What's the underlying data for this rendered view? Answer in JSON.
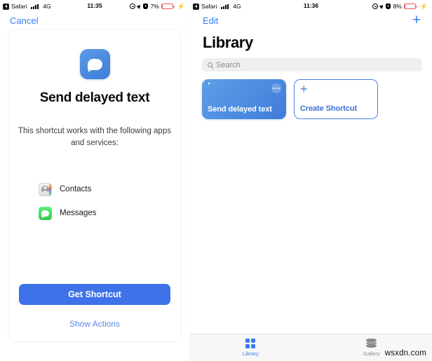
{
  "left_screen": {
    "status_bar": {
      "back_app": "Safari",
      "network": "4G",
      "time": "11:35",
      "battery_percent": "7%",
      "icons": [
        "back-arrow-icon",
        "signal-bars-icon",
        "do-not-disturb-icon",
        "location-arrow-icon",
        "alarm-icon",
        "battery-icon",
        "charging-bolt-icon"
      ]
    },
    "nav": {
      "cancel_label": "Cancel"
    },
    "shortcut": {
      "icon": "message-bubble-icon",
      "title": "Send delayed text",
      "description": "This shortcut works with the following apps and services:",
      "apps": [
        {
          "name": "Contacts",
          "icon": "contacts-app-icon"
        },
        {
          "name": "Messages",
          "icon": "messages-app-icon"
        }
      ]
    },
    "footer": {
      "get_shortcut_label": "Get Shortcut",
      "show_actions_label": "Show Actions"
    }
  },
  "right_screen": {
    "status_bar": {
      "back_app": "Safari",
      "network": "4G",
      "time": "11:36",
      "battery_percent": "8%",
      "icons": [
        "back-arrow-icon",
        "signal-bars-icon",
        "do-not-disturb-icon",
        "location-arrow-icon",
        "alarm-icon",
        "battery-icon",
        "charging-bolt-icon"
      ]
    },
    "nav": {
      "edit_label": "Edit",
      "add_label": "+"
    },
    "page_title": "Library",
    "search": {
      "placeholder": "Search",
      "value": "",
      "icon": "search-icon"
    },
    "cards": [
      {
        "label": "Send delayed text",
        "icon": "message-bubble-icon",
        "menu_icon": "ellipsis-icon",
        "type": "shortcut"
      },
      {
        "label": "Create Shortcut",
        "icon": "plus-icon",
        "type": "create"
      }
    ],
    "tabs": [
      {
        "label": "Library",
        "icon": "grid-icon",
        "active": true
      },
      {
        "label": "Gallery",
        "icon": "layers-icon",
        "active": false
      }
    ]
  },
  "watermark": "wsxdn.com",
  "colors": {
    "accent_blue": "#3a7bf0",
    "button_blue": "#3d72e8",
    "card_blue_start": "#5e9fe6",
    "card_blue_end": "#3f7cdb",
    "messages_green": "#2ecb4e",
    "battery_red": "#e45b5b",
    "search_bg": "#efeff0",
    "tabbar_bg": "#f7f7f8"
  }
}
